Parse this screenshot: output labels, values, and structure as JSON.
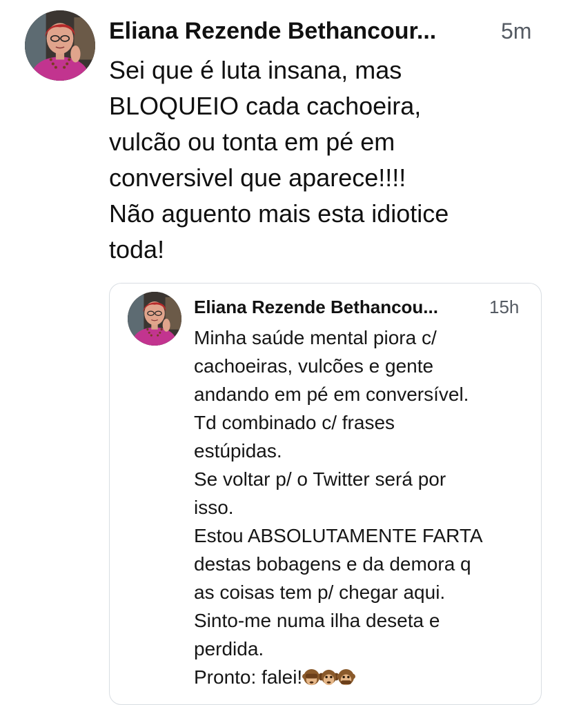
{
  "post": {
    "author": "Eliana Rezende Bethancour...",
    "time": "5m",
    "lines": [
      "Sei que é luta insana, mas",
      "BLOQUEIO cada cachoeira,",
      "vulcão ou tonta em pé  em",
      "conversivel que aparece!!!!",
      "Não aguento mais esta idiotice",
      "toda!"
    ]
  },
  "quote": {
    "author": "Eliana Rezende Bethancou...",
    "time": "15h",
    "lines": [
      "Minha saúde mental piora c/",
      "cachoeiras, vulcões e gente",
      "andando em pé em conversível.",
      "Td combinado c/ frases",
      "estúpidas.",
      "Se voltar p/ o Twitter será por",
      "isso.",
      "Estou ABSOLUTAMENTE FARTA",
      "destas bobagens e da demora q",
      "as coisas tem p/ chegar aqui.",
      "Sinto-me numa ilha deseta e",
      "perdida.",
      "Pronto: falei!"
    ],
    "emoji": [
      "see-no-evil-monkey-icon",
      "hear-no-evil-monkey-icon",
      "speak-no-evil-monkey-icon"
    ]
  }
}
